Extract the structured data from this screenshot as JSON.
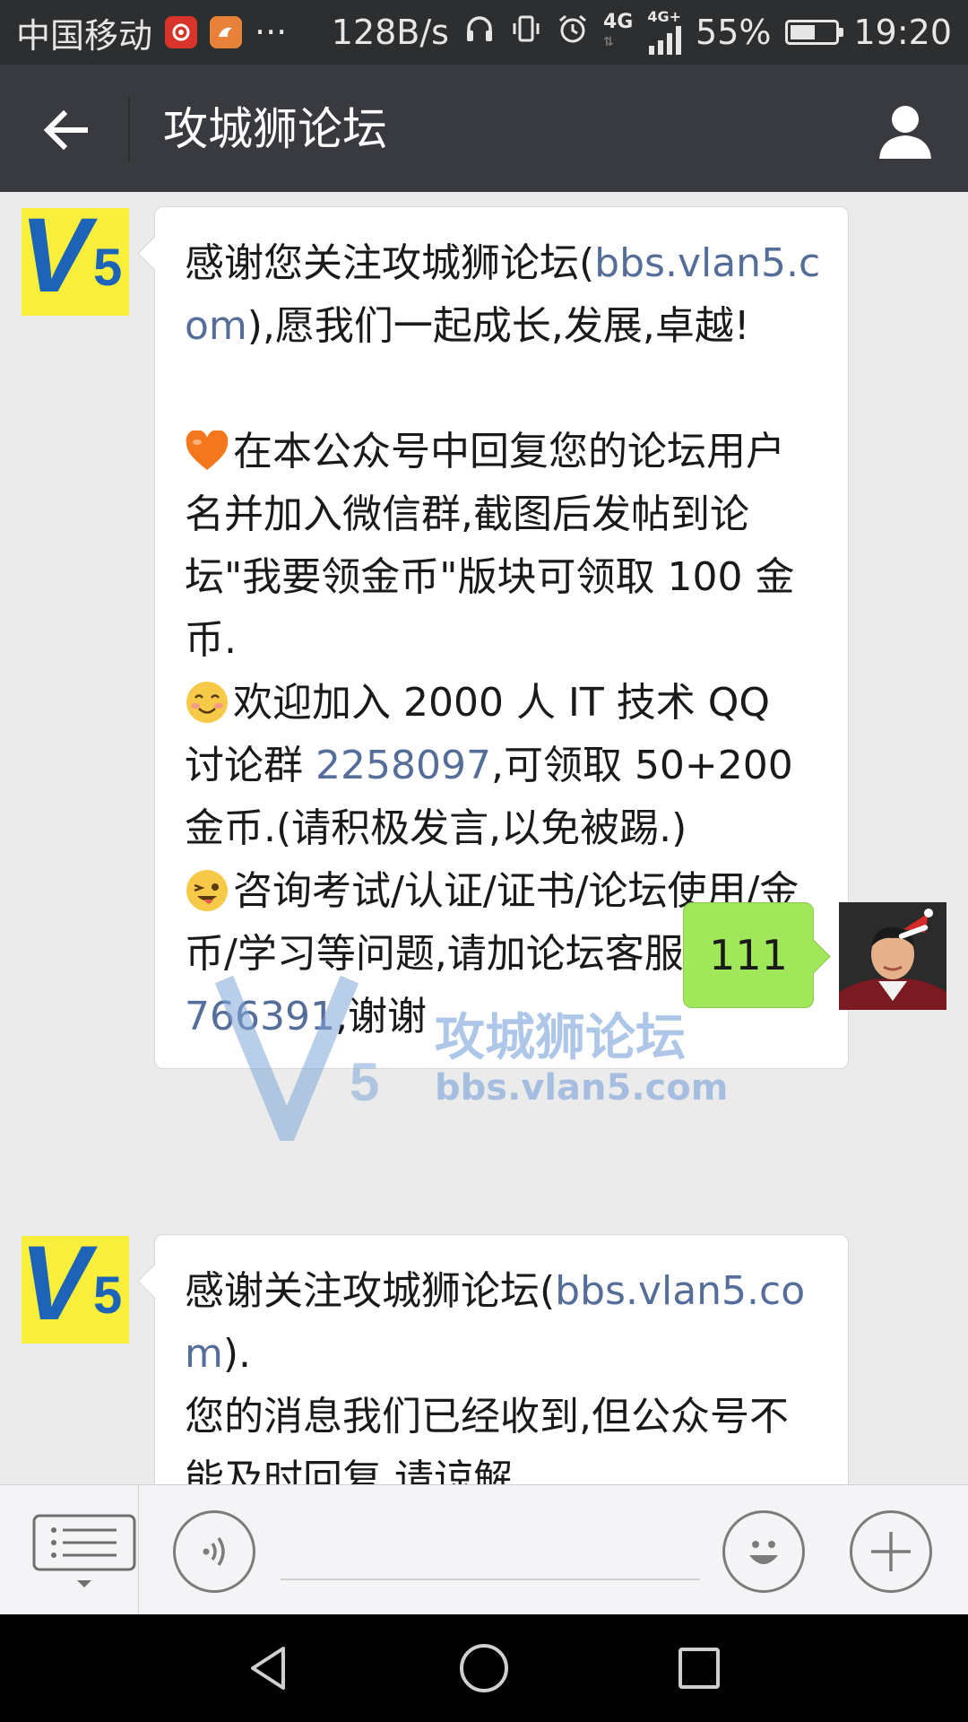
{
  "status_bar": {
    "carrier": "中国移动",
    "more": "···",
    "net_speed": "128B/s",
    "network": "4G",
    "network2": "4G+",
    "battery": "55%",
    "battery_level": 0.55,
    "time": "19:20"
  },
  "header": {
    "title": "攻城狮论坛",
    "back_icon": "arrow-left-icon",
    "profile_icon": "person-icon"
  },
  "messages": [
    {
      "sender": "official_account",
      "paragraphs": [
        {
          "parts": [
            {
              "t": "感谢您关注攻城狮论坛("
            },
            {
              "t": "bbs.vlan5.com",
              "link": true
            },
            {
              "t": "),愿我们一起成长,发展,卓越!"
            }
          ]
        },
        {
          "parts": [
            {
              "t": ""
            }
          ]
        },
        {
          "emoji": "heart-emoji",
          "parts": [
            {
              "t": "在本公众号中回复您的论坛用户名并加入微信群,截图后发帖到论坛\"我要领金币\"版块可领取 100 金币."
            }
          ]
        },
        {
          "emoji": "smile-emoji",
          "parts": [
            {
              "t": "欢迎加入 2000 人 IT 技术 QQ 讨论群 "
            },
            {
              "t": "2258097",
              "link": true
            },
            {
              "t": ",可领取 50+200 金币.(请积极发言,以免被踢.)"
            }
          ]
        },
        {
          "emoji": "wink-emoji",
          "parts": [
            {
              "t": "咨询考试/认证/证书/论坛使用/金币/学习等问题,请加论坛客服 QQ"
            },
            {
              "t": "80766391",
              "link": true
            },
            {
              "t": ",谢谢"
            }
          ]
        }
      ]
    },
    {
      "sender": "me",
      "text": "111"
    },
    {
      "sender": "official_account",
      "paragraphs": [
        {
          "parts": [
            {
              "t": "感谢关注攻城狮论坛("
            },
            {
              "t": "bbs.vlan5.com",
              "link": true
            },
            {
              "t": ")."
            }
          ]
        },
        {
          "parts": [
            {
              "t": "您的消息我们已经收到,但公众号不能及时回复,请谅解."
            }
          ]
        }
      ]
    }
  ],
  "avatar_logo_text": "V5",
  "watermark": {
    "title": "攻城狮论坛",
    "url": "bbs.vlan5.com"
  },
  "input_bar": {
    "menu_icon": "menu-list-icon",
    "voice_icon": "voice-icon",
    "emoji_icon": "emoji-face-icon",
    "plus_icon": "plus-icon",
    "text": ""
  },
  "nav_bar": {
    "back": "nav-back-icon",
    "home": "nav-home-icon",
    "recents": "nav-recents-icon"
  },
  "colors": {
    "title_bar": "#393a3f",
    "status_bar": "#2c2e30",
    "chat_bg": "#ebebeb",
    "link": "#556d99",
    "outgoing_bubble": "#a0e75a"
  }
}
